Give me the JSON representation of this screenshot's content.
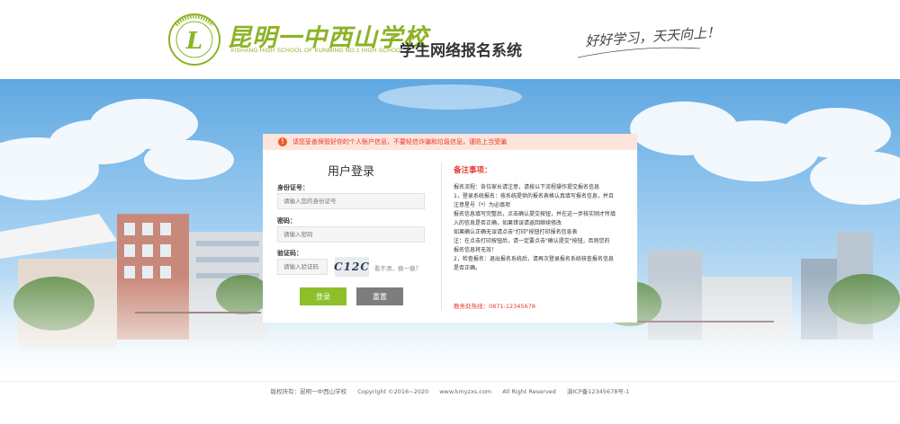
{
  "header": {
    "school_name": "昆明一中西山学校",
    "school_name_en": "XISHANG HIGH SCHOOL OF KUNMING NO.1 HIGH SCHOOL",
    "system_title": "学生网络报名系统",
    "slogan": "好好学习，天天向上！",
    "emblem_letter": "L",
    "emblem_ring_text": "昆明市第一中学西山学校"
  },
  "warning": {
    "icon": "!",
    "text": "请您妥善保管好你的个人账户信息，不要轻信诈骗和垃圾信息，谨防上当受骗"
  },
  "login": {
    "title": "用户登录",
    "id_label": "身份证号：",
    "id_placeholder": "请输入您的身份证号",
    "password_label": "密码：",
    "password_placeholder": "请输入密码",
    "captcha_label": "验证码：",
    "captcha_placeholder": "请输入验证码",
    "captcha_text": "C12C",
    "refresh_text": "看不清，换一换？",
    "login_button": "登录",
    "reset_button": "重置"
  },
  "notes": {
    "title": "备注事项：",
    "lines": [
      "报名流程：各位家长请注意，请按以下流程操作提交报名信息",
      "1，登录系统报名：按系统提供的报名表格认真填写报名信息，并且",
      "注意星号（*）为必填项",
      "报名信息填写完整后，点击确认提交按钮，并在这一步核实刚才所填",
      "入的信息是否正确，如果错误请返回继续修改",
      "如果确认正确无误请点击\"打印\"按钮打印报名信息表",
      "注：在点击打印按钮后，请一定要点击\"确认提交\"按钮，否则您的",
      "报名信息将无效！",
      "2，检查报名：退出报名系统后，请再次登录报名系统核查报名信息",
      "是否正确。"
    ],
    "hotline": "教务处热线：0871-12345678"
  },
  "footer": {
    "copyright_owner": "版权所有：昆明一中西山学校",
    "copyright": "Copyright ©2016~2020",
    "website": "www.kmyzxs.com",
    "rights": "All Right Reserved",
    "icp": "滇ICP备12345678号-1"
  },
  "colors": {
    "brand_green": "#8cb327",
    "login_button": "#8dbf2a",
    "reset_button": "#7d7d7d",
    "warning_bg": "#fde5dc",
    "warning_text": "#e8362b",
    "sky": "#6fb4e6"
  }
}
